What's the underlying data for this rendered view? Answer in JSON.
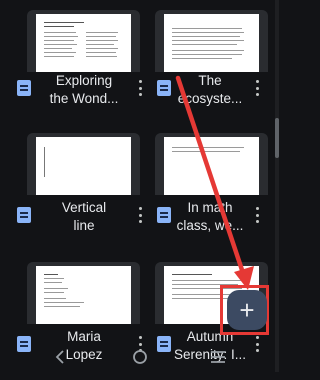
{
  "documents": [
    {
      "title_line1": "Exploring",
      "title_line2": "the Wond...",
      "doc_icon": "google-docs-icon",
      "menu_icon": "more-vert-icon"
    },
    {
      "title_line1": "The",
      "title_line2": "ecosyste...",
      "doc_icon": "google-docs-icon",
      "menu_icon": "more-vert-icon"
    },
    {
      "title_line1": "Vertical",
      "title_line2": "line",
      "doc_icon": "google-docs-icon",
      "menu_icon": "more-vert-icon"
    },
    {
      "title_line1": "In math",
      "title_line2": "class, we...",
      "doc_icon": "google-docs-icon",
      "menu_icon": "more-vert-icon"
    },
    {
      "title_line1": "Maria",
      "title_line2": "Lopez",
      "doc_icon": "google-docs-icon",
      "menu_icon": "more-vert-icon"
    },
    {
      "title_line1": "Autumn",
      "title_line2": "Serenity: I...",
      "doc_icon": "google-docs-icon",
      "menu_icon": "more-vert-icon"
    }
  ],
  "fab": {
    "label": "+",
    "icon": "plus-icon",
    "background": "#3c4a62"
  },
  "annotation": {
    "color": "#e53935"
  },
  "system_nav": {
    "back_icon": "back-chevron-icon",
    "home_icon": "home-circle-icon",
    "recents_icon": "recents-lines-icon"
  }
}
